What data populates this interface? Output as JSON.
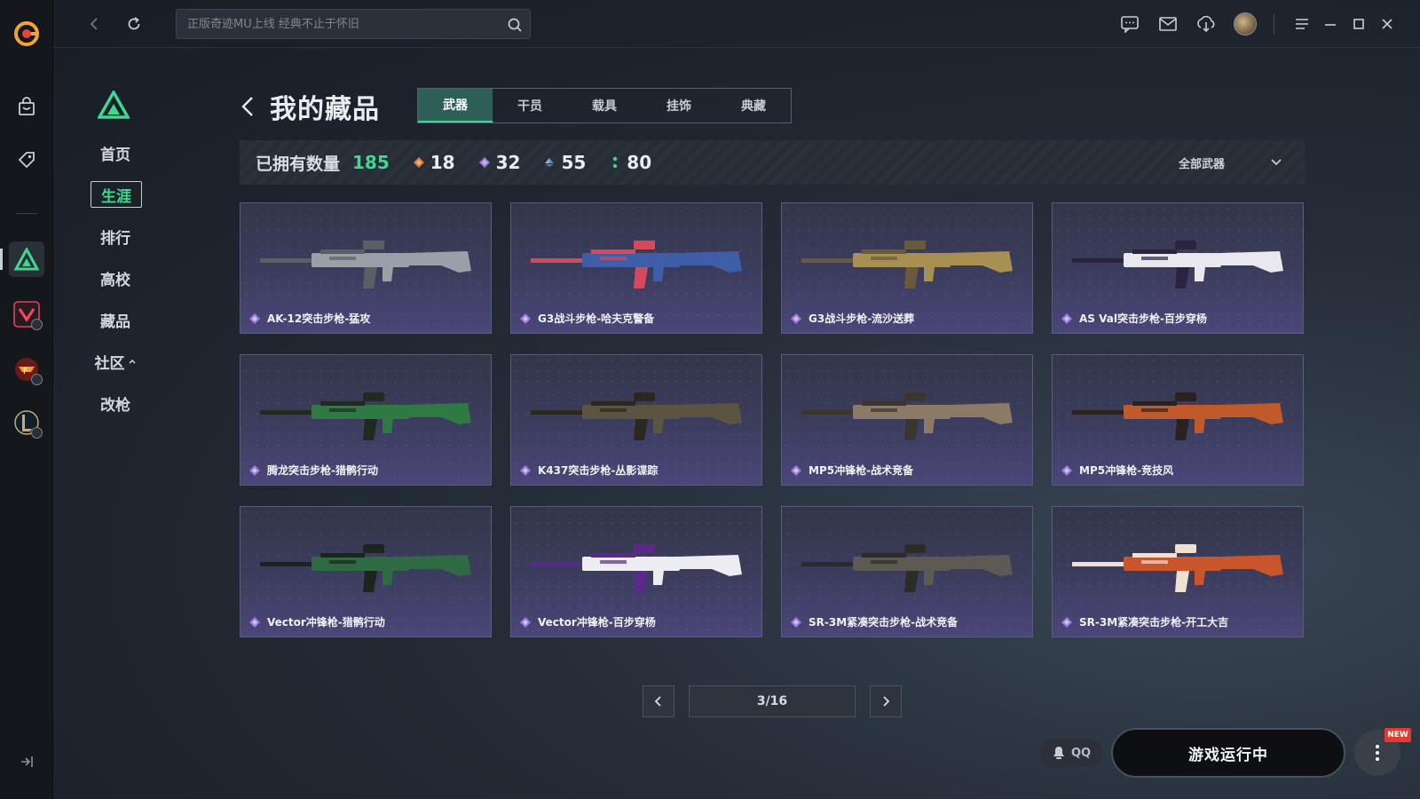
{
  "topbar": {
    "search_placeholder": "正版奇迹MU上线 经典不止于怀旧"
  },
  "sidenav": {
    "items": [
      {
        "label": "首页"
      },
      {
        "label": "生涯"
      },
      {
        "label": "排行"
      },
      {
        "label": "高校"
      },
      {
        "label": "藏品"
      },
      {
        "label": "社区"
      },
      {
        "label": "改枪"
      }
    ],
    "active": "生涯"
  },
  "header": {
    "title": "我的藏品",
    "tabs": [
      {
        "label": "武器",
        "active": true
      },
      {
        "label": "干员",
        "active": false
      },
      {
        "label": "载具",
        "active": false
      },
      {
        "label": "挂饰",
        "active": false
      },
      {
        "label": "典藏",
        "active": false
      }
    ]
  },
  "stats": {
    "owned_label": "已拥有数量",
    "owned_total": "185",
    "rarity_counts": [
      {
        "value": "18",
        "color": "#e07a3a"
      },
      {
        "value": "32",
        "color": "#9b7be0"
      },
      {
        "value": "55",
        "color": "#4a8fe0"
      },
      {
        "value": "80",
        "color": "#3fd890"
      }
    ],
    "filter_label": "全部武器"
  },
  "items": [
    {
      "name": "AK-12突击步枪-猛攻",
      "color": "#9aa0a8",
      "accent": "#5a5f66"
    },
    {
      "name": "G3战斗步枪-哈夫克警备",
      "color": "#3f5ea8",
      "accent": "#d44a5a"
    },
    {
      "name": "G3战斗步枪-流沙送葬",
      "color": "#a88f52",
      "accent": "#6a5a3a"
    },
    {
      "name": "AS Val突击步枪-百步穿杨",
      "color": "#e8e8ee",
      "accent": "#2a2440"
    },
    {
      "name": "腾龙突击步枪-猎鹘行动",
      "color": "#2f7a42",
      "accent": "#1f2a22"
    },
    {
      "name": "K437突击步枪-丛影谍踪",
      "color": "#5a5440",
      "accent": "#2a2820"
    },
    {
      "name": "MP5冲锋枪-战术竞备",
      "color": "#8a7a66",
      "accent": "#3a3530"
    },
    {
      "name": "MP5冲锋枪-竞技风",
      "color": "#c05a2a",
      "accent": "#2a2220"
    },
    {
      "name": "Vector冲锋枪-猎鹘行动",
      "color": "#2f6a44",
      "accent": "#1c241e"
    },
    {
      "name": "Vector冲锋枪-百步穿杨",
      "color": "#ececf2",
      "accent": "#5a2a8a"
    },
    {
      "name": "SR-3M紧凑突击步枪-战术竞备",
      "color": "#5c5a52",
      "accent": "#2c2b28"
    },
    {
      "name": "SR-3M紧凑突击步枪-开工大吉",
      "color": "#c8552c",
      "accent": "#f0e0d0"
    }
  ],
  "pager": {
    "value": "3/16"
  },
  "footer": {
    "qq_label": "QQ",
    "launch_label": "游戏运行中",
    "new_badge": "NEW"
  },
  "colors": {
    "accent_green": "#3fd890",
    "rarity_item": "#9b7be0"
  },
  "icons": [
    "app-logo-icon",
    "shop-icon",
    "tag-icon",
    "delta-icon",
    "valorant-icon",
    "cf-icon",
    "lol-icon",
    "collapse-icon",
    "back-icon",
    "refresh-icon",
    "search-icon",
    "chat-icon",
    "mail-icon",
    "download-icon",
    "menu-icon",
    "minimize-icon",
    "maximize-icon",
    "close-icon"
  ]
}
